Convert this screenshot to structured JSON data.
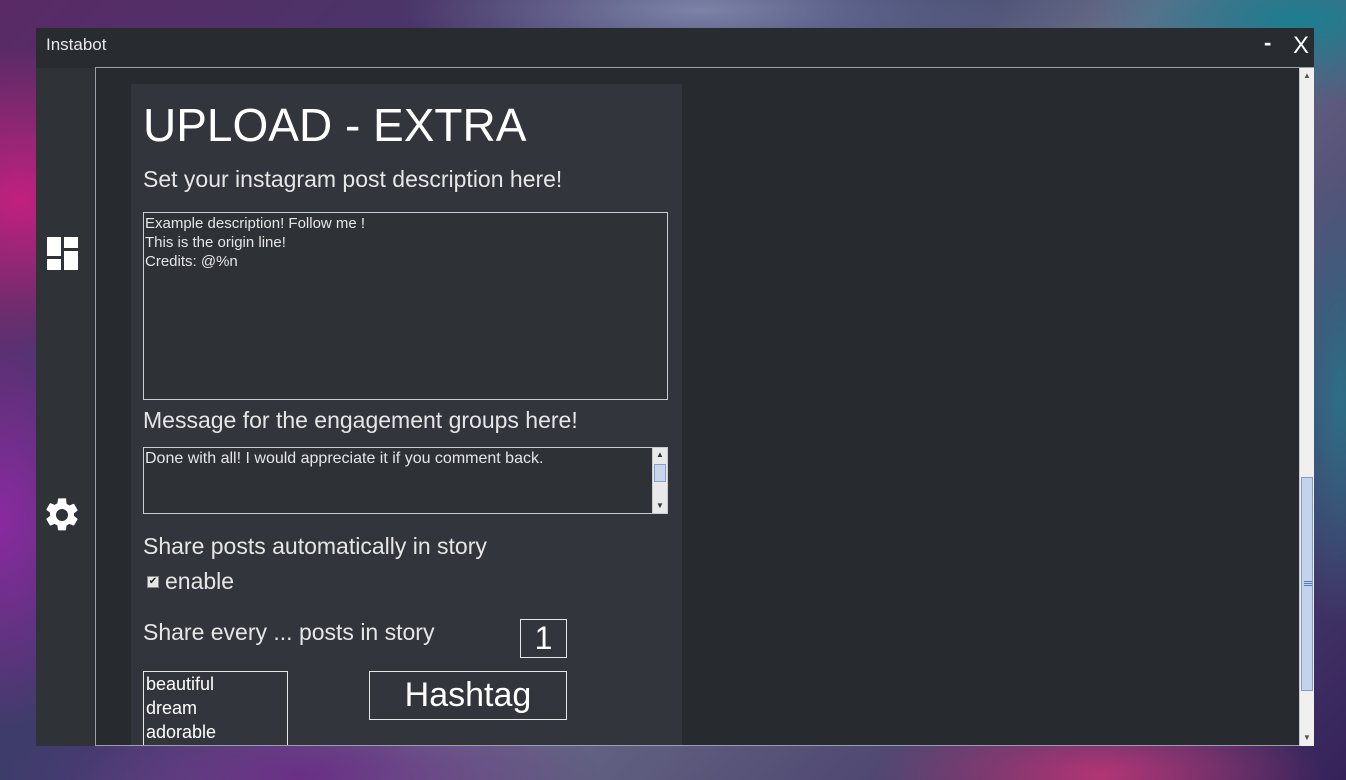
{
  "window": {
    "title": "Instabot",
    "minimize_label": "-",
    "close_label": "X"
  },
  "sidebar": {
    "items": [
      {
        "icon": "dashboard-icon"
      },
      {
        "icon": "gear-icon"
      }
    ]
  },
  "upload_extra": {
    "heading": "UPLOAD - EXTRA",
    "description_label": "Set your instagram post description here!",
    "description_lines": [
      "Example description! Follow me !",
      "This is the origin line!",
      "Credits: @%n"
    ],
    "engagement_label": "Message for the engagement groups here!",
    "engagement_message": "Done with all! I would appreciate it if you comment back.",
    "story_label": "Share posts automatically in story",
    "enable_label": "enable",
    "enable_checked": true,
    "share_every_label": "Share every ... posts in story",
    "share_every_value": "1",
    "hashtags": [
      "beautiful",
      "dream",
      "adorable"
    ],
    "hashtag_button": "Hashtag"
  }
}
